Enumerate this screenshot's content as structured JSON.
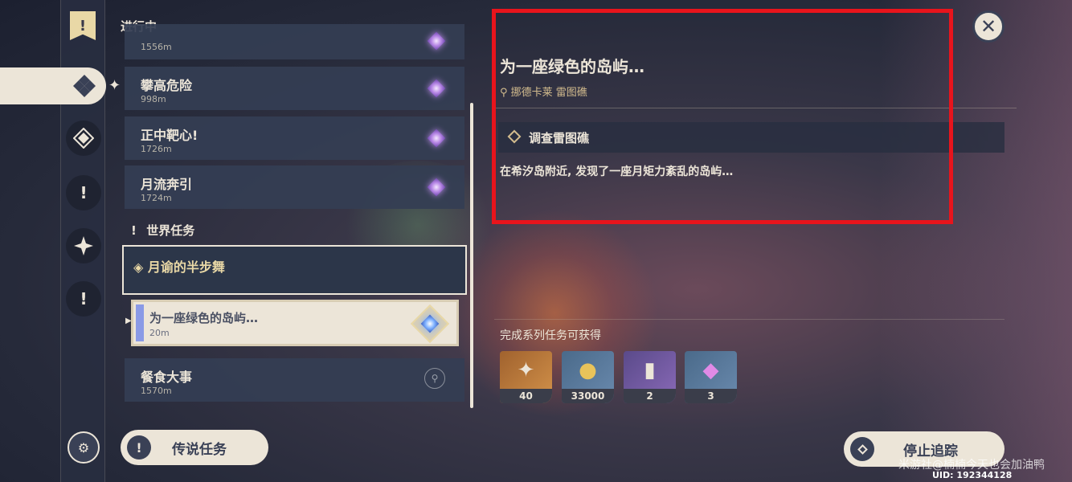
{
  "header": {
    "in_progress_label": "进行中"
  },
  "quests_in_progress": [
    {
      "title": "",
      "distance": "1556m",
      "icon": "purple-diamond-icon"
    },
    {
      "title": "攀高危险",
      "distance": "998m",
      "icon": "purple-diamond-icon"
    },
    {
      "title": "正中靶心!",
      "distance": "1726m",
      "icon": "purple-diamond-icon"
    },
    {
      "title": "月流奔引",
      "distance": "1724m",
      "icon": "purple-diamond-icon"
    }
  ],
  "world_quests": {
    "heading": "世界任务",
    "group_title": "月谕的半步舞",
    "selected": {
      "title": "为一座绿色的岛屿…",
      "distance": "20m",
      "icon": "blue-diamond-icon"
    },
    "next": {
      "title": "餐食大事",
      "distance": "1570m",
      "icon": "location-pin-icon"
    }
  },
  "detail": {
    "title": "为一座绿色的岛屿…",
    "location": "挪德卡莱 雷图礁",
    "objective": "调查雷图礁",
    "description": "在希汐岛附近, 发现了一座月矩力紊乱的岛屿…"
  },
  "rewards": {
    "heading": "完成系列任务可获得",
    "items": [
      {
        "name": "primogem",
        "count": "40"
      },
      {
        "name": "mora",
        "count": "33000"
      },
      {
        "name": "heros-wit",
        "count": "2"
      },
      {
        "name": "crystal",
        "count": "3"
      }
    ]
  },
  "buttons": {
    "legend_quests": "传说任务",
    "stop_tracking": "停止追踪"
  },
  "watermark": "米游社@楠楠今天也会加油鸭",
  "uid": "UID: 192344128",
  "colors": {
    "highlight_box": "#e8141c",
    "panel": "#ece5d8",
    "accent_gold": "#d3bc8e"
  }
}
